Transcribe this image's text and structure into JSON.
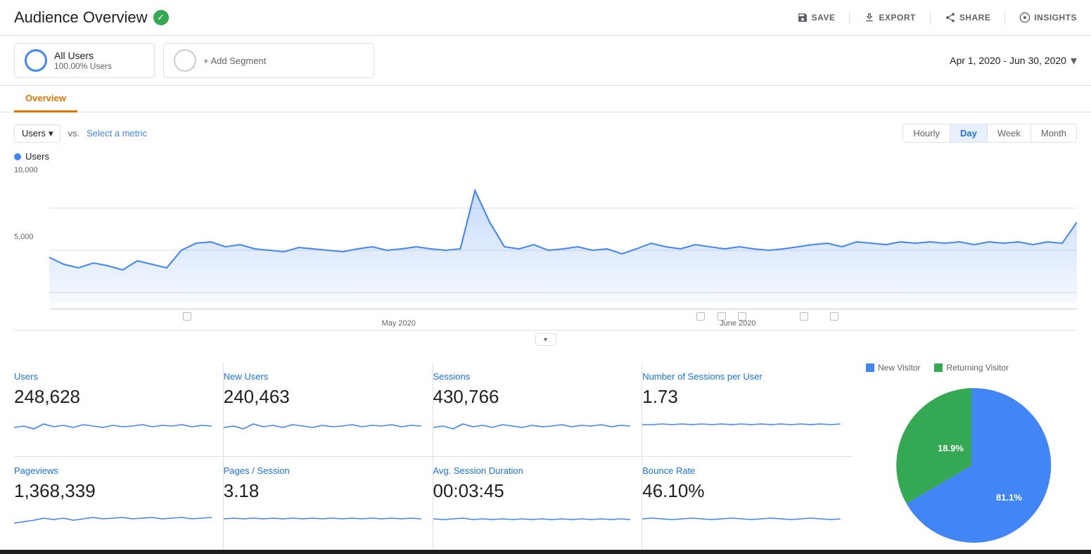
{
  "header": {
    "title": "Audience Overview",
    "verified": true,
    "actions": [
      {
        "label": "SAVE",
        "icon": "save"
      },
      {
        "label": "EXPORT",
        "icon": "export"
      },
      {
        "label": "SHARE",
        "icon": "share"
      },
      {
        "label": "INSIGHTS",
        "icon": "insights"
      }
    ]
  },
  "segments": {
    "all_users": {
      "name": "All Users",
      "sub": "100.00% Users"
    },
    "add_label": "+ Add Segment"
  },
  "date_range": "Apr 1, 2020 - Jun 30, 2020",
  "tabs": [
    "Overview"
  ],
  "chart": {
    "metric_label": "Users",
    "vs_label": "vs.",
    "select_metric": "Select a metric",
    "y_labels": [
      "10,000",
      "5,000"
    ],
    "x_labels": [
      "May 2020",
      "June 2020"
    ],
    "period_buttons": [
      "Hourly",
      "Day",
      "Week",
      "Month"
    ],
    "active_period": "Day"
  },
  "metrics": [
    {
      "title": "Users",
      "value": "248,628"
    },
    {
      "title": "New Users",
      "value": "240,463"
    },
    {
      "title": "Sessions",
      "value": "430,766"
    },
    {
      "title": "Number of Sessions per User",
      "value": "1.73"
    },
    {
      "title": "Pageviews",
      "value": "1,368,339"
    },
    {
      "title": "Pages / Session",
      "value": "3.18"
    },
    {
      "title": "Avg. Session Duration",
      "value": "00:03:45"
    },
    {
      "title": "Bounce Rate",
      "value": "46.10%"
    }
  ],
  "pie": {
    "new_visitor_label": "New Visitor",
    "returning_label": "Returning Visitor",
    "new_pct": 81.1,
    "returning_pct": 18.9,
    "new_color": "#4285f4",
    "returning_color": "#34a853"
  }
}
